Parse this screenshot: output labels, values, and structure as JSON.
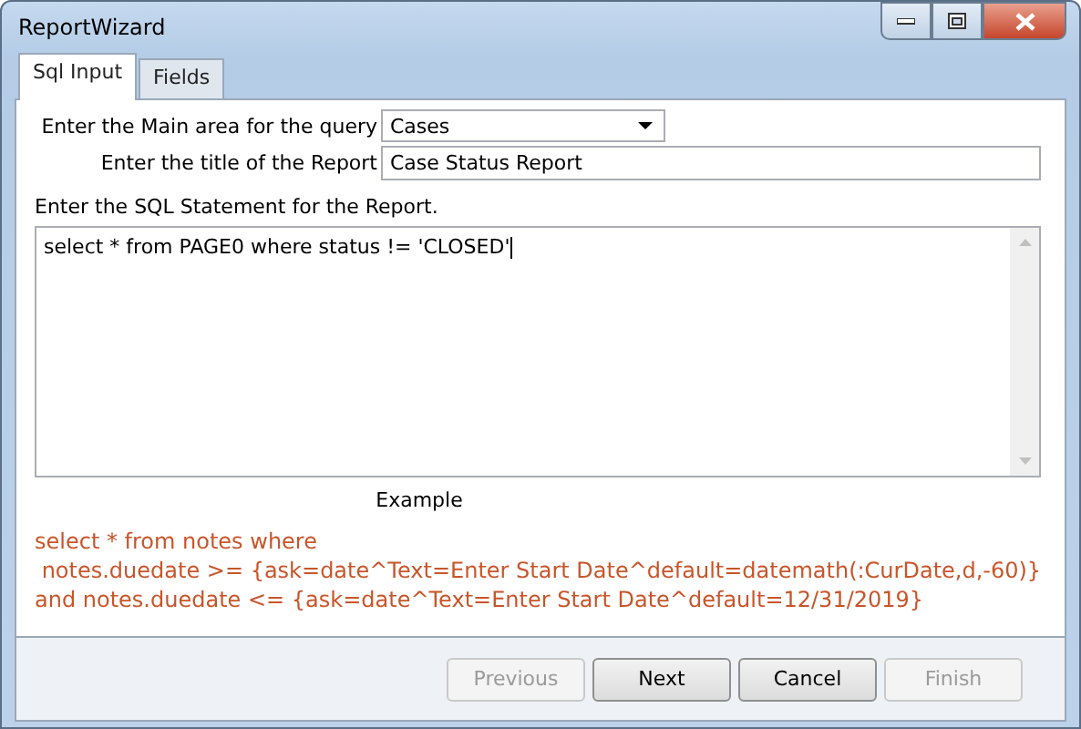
{
  "window": {
    "title": "ReportWizard"
  },
  "tabs": [
    {
      "label": "Sql Input",
      "selected": true
    },
    {
      "label": "Fields",
      "selected": false
    }
  ],
  "main_area": {
    "label": "Enter the Main area for the query",
    "value": "Cases"
  },
  "report_title": {
    "label": "Enter the title of the Report",
    "value": "Case Status Report"
  },
  "sql": {
    "label": "Enter the SQL Statement for the Report.",
    "value": "select * from PAGE0 where status != 'CLOSED'"
  },
  "example": {
    "heading": "Example",
    "lines": [
      "select * from notes where",
      " notes.duedate >= {ask=date^Text=Enter Start Date^default=datemath(:CurDate,d,-60)}",
      "and notes.duedate <= {ask=date^Text=Enter Start Date^default=12/31/2019}"
    ]
  },
  "buttons": [
    {
      "label": "Previous",
      "disabled": true
    },
    {
      "label": "Next",
      "disabled": false
    },
    {
      "label": "Cancel",
      "disabled": false
    },
    {
      "label": "Finish",
      "disabled": true
    }
  ]
}
